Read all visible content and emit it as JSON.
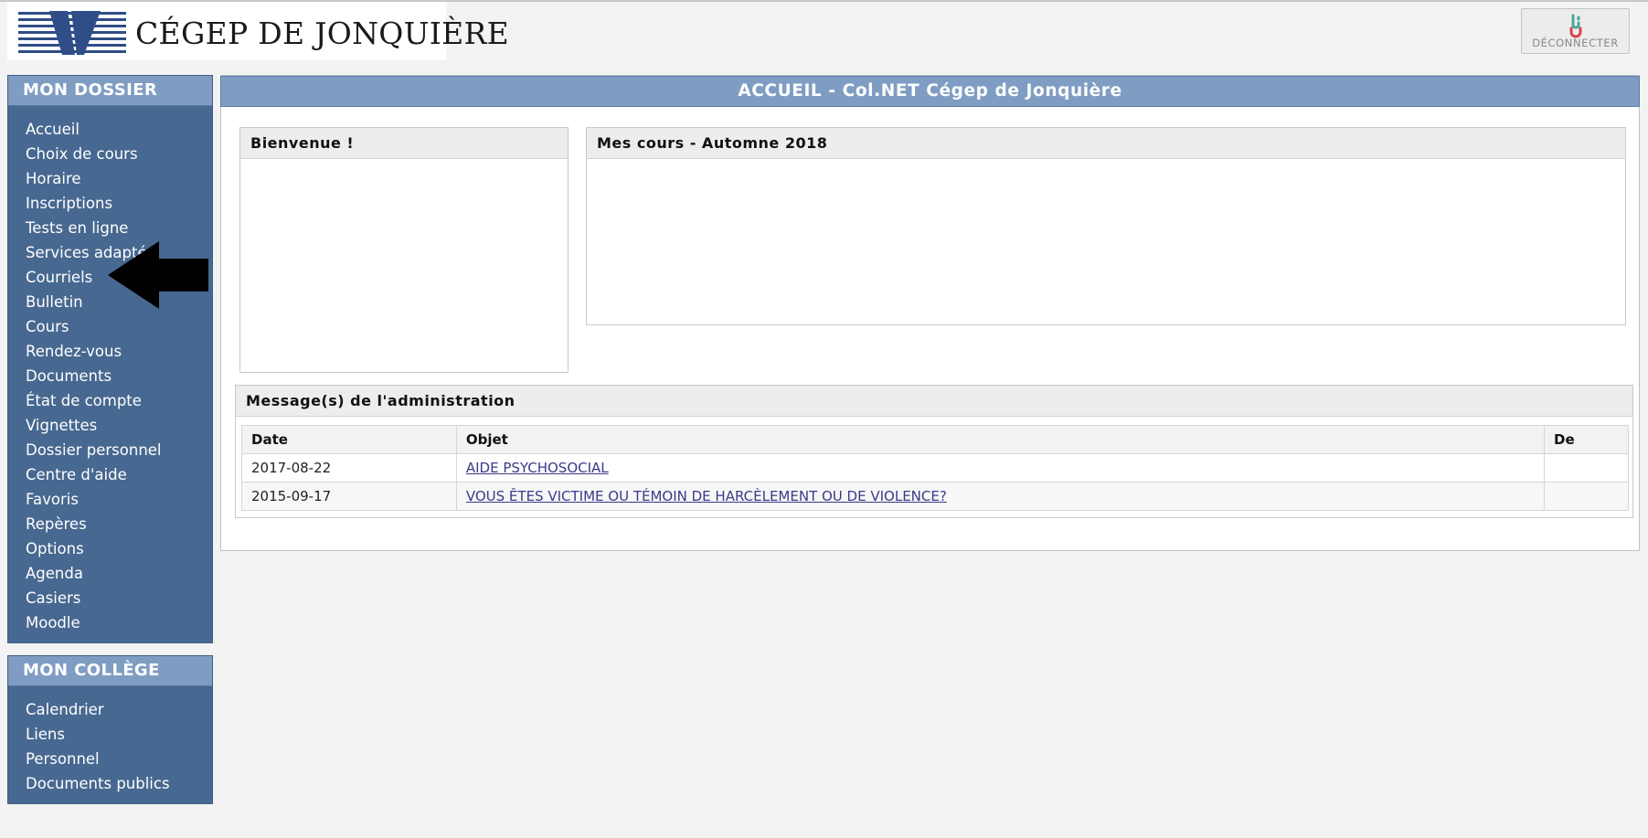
{
  "header": {
    "logo_text": "CÉGEP DE JONQUIÈRE",
    "logout_label": "DÉCONNECTER"
  },
  "sidebar": {
    "dossier_title": "MON DOSSIER",
    "dossier_items": [
      "Accueil",
      "Choix de cours",
      "Horaire",
      "Inscriptions",
      "Tests en ligne",
      "Services adaptés",
      "Courriels",
      "Bulletin",
      "Cours",
      "Rendez-vous",
      "Documents",
      "État de compte",
      "Vignettes",
      "Dossier personnel",
      "Centre d'aide",
      "Favoris",
      "Repères",
      "Options",
      "Agenda",
      "Casiers",
      "Moodle"
    ],
    "college_title": "MON COLLÈGE",
    "college_items": [
      "Calendrier",
      "Liens",
      "Personnel",
      "Documents publics"
    ]
  },
  "main": {
    "title": "ACCUEIL - Col.NET Cégep de Jonquière",
    "welcome_title": "Bienvenue !",
    "courses_title": "Mes cours - Automne 2018",
    "messages_title": "Message(s) de l'administration",
    "messages": {
      "columns": [
        "Date",
        "Objet",
        "De"
      ],
      "rows": [
        {
          "date": "2017-08-22",
          "objet": "AIDE PSYCHOSOCIAL",
          "de": ""
        },
        {
          "date": "2015-09-17",
          "objet": "VOUS ÊTES VICTIME OU TÉMOIN DE HARCÈLEMENT OU DE VIOLENCE?",
          "de": ""
        }
      ]
    }
  },
  "colors": {
    "sidebar_bg": "#476890",
    "panel_header_bg": "#7f9dc3",
    "link_color": "#3a3a8a",
    "annotation_arrow": "#000000"
  },
  "icons": {
    "logout": "power-plug-icon",
    "annotation": "arrow-left-icon"
  }
}
